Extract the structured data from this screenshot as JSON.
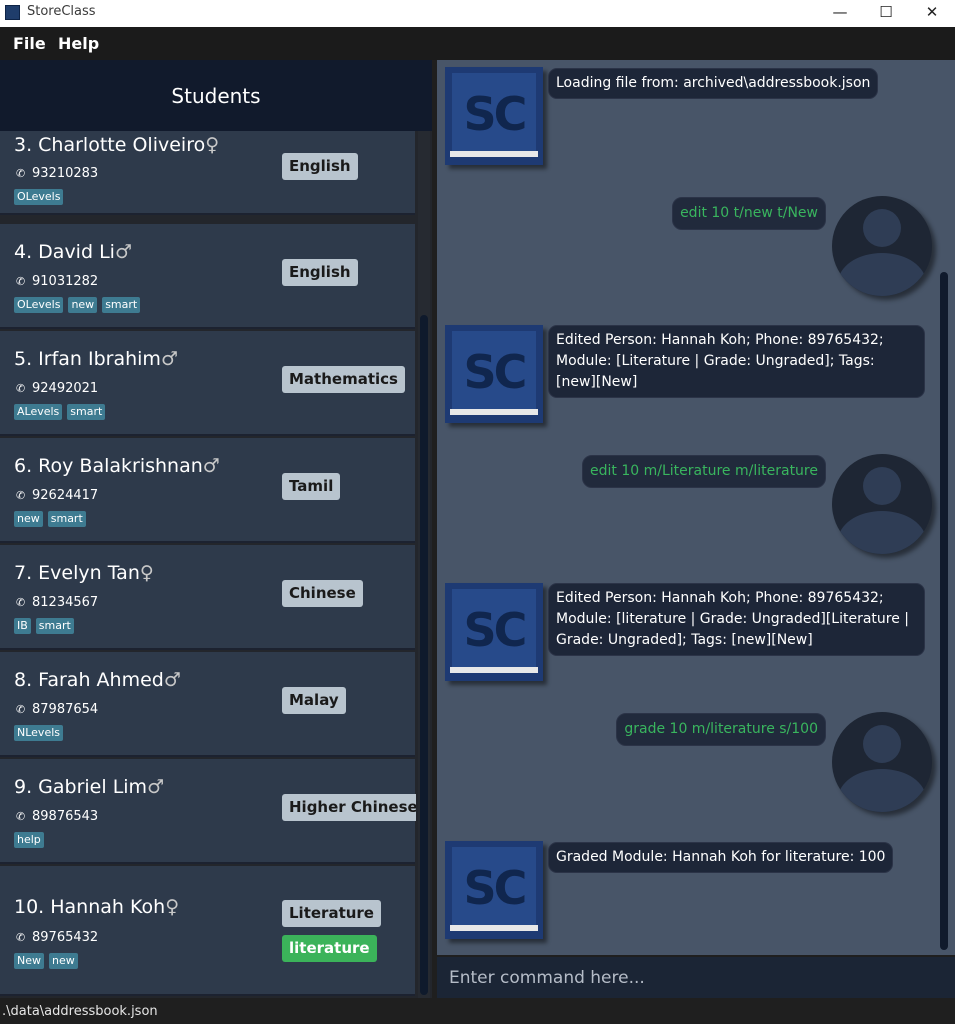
{
  "window": {
    "title": "StoreClass",
    "minimize_glyph": "—",
    "maximize_glyph": "☐",
    "close_glyph": "✕"
  },
  "menu": {
    "file": "File",
    "help": "Help"
  },
  "students_header": "Students",
  "students": [
    {
      "name": "3. Charlotte Oliveiro",
      "gender": "♀",
      "phone": "93210283",
      "tags": [
        "OLevels"
      ],
      "modules": [
        "English"
      ]
    },
    {
      "name": "4. David Li",
      "gender": "♂",
      "phone": "91031282",
      "tags": [
        "OLevels",
        "new",
        "smart"
      ],
      "modules": [
        "English"
      ]
    },
    {
      "name": "5. Irfan Ibrahim",
      "gender": "♂",
      "phone": "92492021",
      "tags": [
        "ALevels",
        "smart"
      ],
      "modules": [
        "Mathematics"
      ]
    },
    {
      "name": "6. Roy Balakrishnan",
      "gender": "♂",
      "phone": "92624417",
      "tags": [
        "new",
        "smart"
      ],
      "modules": [
        "Tamil"
      ]
    },
    {
      "name": "7. Evelyn Tan",
      "gender": "♀",
      "phone": "81234567",
      "tags": [
        "IB",
        "smart"
      ],
      "modules": [
        "Chinese"
      ]
    },
    {
      "name": "8. Farah Ahmed",
      "gender": "♂",
      "phone": "87987654",
      "tags": [
        "NLevels"
      ],
      "modules": [
        "Malay"
      ]
    },
    {
      "name": "9. Gabriel Lim",
      "gender": "♂",
      "phone": "89876543",
      "tags": [
        "help"
      ],
      "modules": [
        "Higher Chinese"
      ]
    },
    {
      "name": "10. Hannah Koh",
      "gender": "♀",
      "phone": "89765432",
      "tags": [
        "New",
        "new"
      ],
      "modules": [
        "Literature",
        "literature"
      ]
    }
  ],
  "chat": {
    "bot_logo_text": "SC",
    "messages": [
      {
        "from": "bot",
        "text": "Loading file from: archived\\addressbook.json"
      },
      {
        "from": "user",
        "text": "edit 10 t/new t/New"
      },
      {
        "from": "bot",
        "text": "Edited Person: Hannah Koh; Phone: 89765432; Module: [Literature | Grade: Ungraded]; Tags: [new][New]"
      },
      {
        "from": "user",
        "text": "edit 10 m/Literature m/literature"
      },
      {
        "from": "bot",
        "text": "Edited Person: Hannah Koh; Phone: 89765432; Module: [literature | Grade: Ungraded][Literature | Grade: Ungraded]; Tags: [new][New]"
      },
      {
        "from": "user",
        "text": "grade 10 m/literature s/100"
      },
      {
        "from": "bot",
        "text": "Graded Module: Hannah Koh for literature: 100"
      }
    ]
  },
  "command": {
    "placeholder": "Enter command here..."
  },
  "status": {
    "path": ".\\data\\addressbook.json"
  },
  "colors": {
    "card_bg": "#2e3a4b",
    "tag_bg": "#3e7b91",
    "module_bg": "#b8c4ce",
    "graded_module_bg": "#3bb35a",
    "user_text": "#39b55e",
    "chat_bg": "#485568"
  },
  "icons": {
    "app": "app-icon",
    "phone": "phone-icon",
    "bot_avatar": "storeclass-logo",
    "user_avatar": "user-icon"
  }
}
